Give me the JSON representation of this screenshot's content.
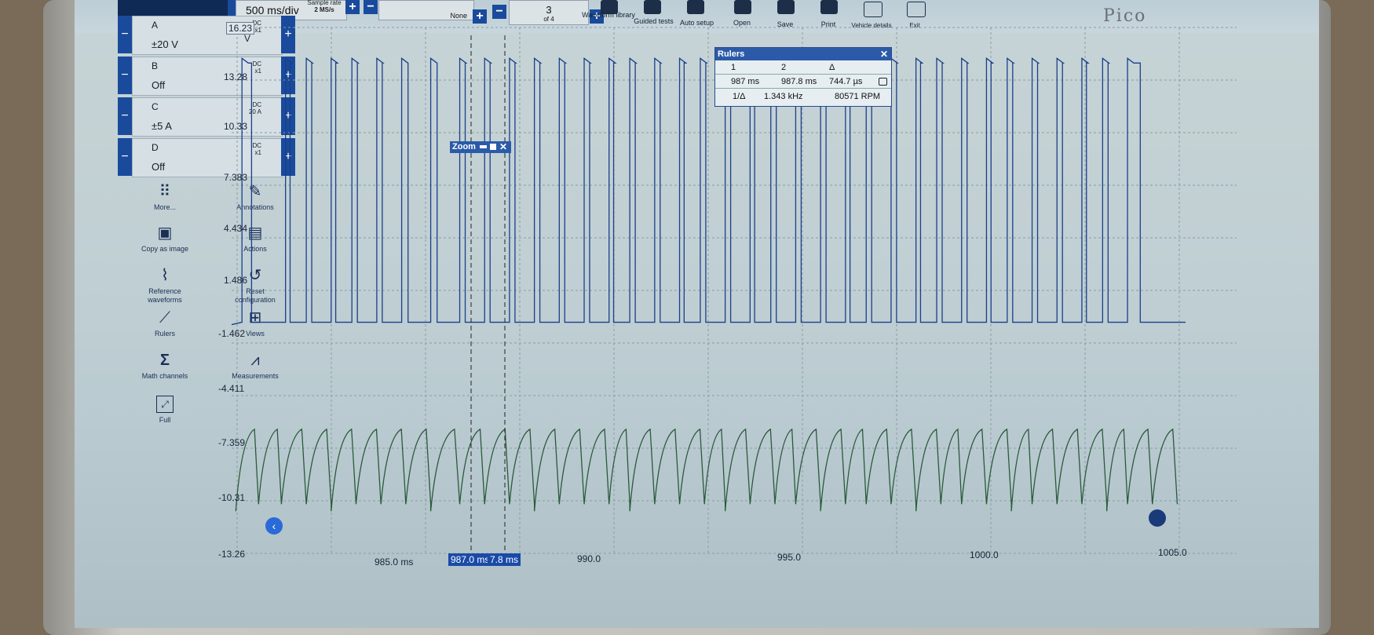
{
  "toolbar": {
    "timebase": "500 ms/div",
    "sample_rate_label": "Sample rate",
    "sample_rate_value": "2 MS/s",
    "trigger_label": "None",
    "buffer_index": "3",
    "buffer_total": "of 4",
    "buttons": [
      "Waveform library",
      "Guided tests",
      "Auto setup",
      "Open",
      "Save",
      "Print",
      "Vehicle details",
      "Exit"
    ],
    "brand": "Pico"
  },
  "channels": [
    {
      "name": "A",
      "coupling": "DC",
      "probe": "x1",
      "range": "±20 V"
    },
    {
      "name": "B",
      "coupling": "DC",
      "probe": "x1",
      "range": "Off"
    },
    {
      "name": "C",
      "coupling": "DC",
      "probe": "20 A",
      "range": "±5 A"
    },
    {
      "name": "D",
      "coupling": "DC",
      "probe": "x1",
      "range": "Off"
    }
  ],
  "tools": [
    {
      "label": "More...",
      "icon": "grid-dots-icon"
    },
    {
      "label": "Annotations",
      "icon": "annotation-pen-icon"
    },
    {
      "label": "Copy as image",
      "icon": "image-icon"
    },
    {
      "label": "Actions",
      "icon": "clapperboard-icon"
    },
    {
      "label": "Reference waveforms",
      "icon": "reference-waveform-icon"
    },
    {
      "label": "Reset configuration",
      "icon": "reset-clock-icon"
    },
    {
      "label": "Rulers",
      "icon": "ruler-icon"
    },
    {
      "label": "Views",
      "icon": "views-grid-icon"
    },
    {
      "label": "Math channels",
      "icon": "sigma-icon"
    },
    {
      "label": "Measurements",
      "icon": "compass-icon"
    },
    {
      "label": "Full",
      "icon": "fullscreen-icon"
    }
  ],
  "y_axis": {
    "unit": "V",
    "top": "16.23",
    "ticks": [
      "13.28",
      "10.33",
      "7.383",
      "4.434",
      "1.486",
      "-1.462",
      "-4.411",
      "-7.359",
      "-10.31",
      "-13.26"
    ]
  },
  "x_axis": {
    "ticks": [
      "985.0 ms",
      "990.0",
      "995.0",
      "1000.0",
      "1005.0"
    ]
  },
  "zoom_window": {
    "label": "Zoom"
  },
  "rulers": {
    "title": "Rulers",
    "col1": "1",
    "col2": "2",
    "col3": "Δ",
    "r1": "987 ms",
    "r2": "987.8 ms",
    "delta": "744.7 µs",
    "inv_label": "1/Δ",
    "freq": "1.343 kHz",
    "rpm": "80571 RPM"
  },
  "cursors": {
    "c1": "987.0 ms",
    "c2": "7.8 ms"
  },
  "chart_data": {
    "type": "line",
    "xlabel": "",
    "ylabel": "V",
    "xlim": [
      982.2,
      1005.2
    ],
    "ylim": [
      -13.26,
      16.23
    ],
    "series": [
      {
        "color": "#1b3f8a",
        "values_description_only": false,
        "pulse_times": [
          982.45,
          983.5,
          984.0,
          984.6,
          985.1,
          985.7,
          986.3,
          987.0,
          987.7,
          988.3,
          988.9,
          989.5,
          990.1,
          990.7,
          991.3,
          991.8,
          992.4,
          993.0,
          993.5,
          994.1,
          994.7,
          995.2,
          995.8,
          996.4,
          997.0,
          997.5,
          998.1,
          998.7,
          999.2,
          999.8,
          1000.4,
          1000.9,
          1001.5,
          1002.1,
          1002.7,
          1003.2,
          1003.8
        ],
        "low_level": -0.3,
        "high_level": 14.5
      },
      {
        "color": "#2a5a3a",
        "ramp_times": [
          982.3,
          982.85,
          983.4,
          984.0,
          984.6,
          985.2,
          985.8,
          986.4,
          987.0,
          987.7,
          988.3,
          988.9,
          989.5,
          990.1,
          990.7,
          991.3,
          991.8,
          992.4,
          993.0,
          993.6,
          994.1,
          994.7,
          995.3,
          995.8,
          996.4,
          997.0,
          997.5,
          998.1,
          998.7,
          999.3,
          999.8,
          1000.4,
          1001.0,
          1001.5,
          1002.1,
          1002.7,
          1003.3,
          1003.8,
          1004.4,
          1005.0
        ],
        "low_level": -10.5,
        "high_level": -6.3
      }
    ]
  }
}
